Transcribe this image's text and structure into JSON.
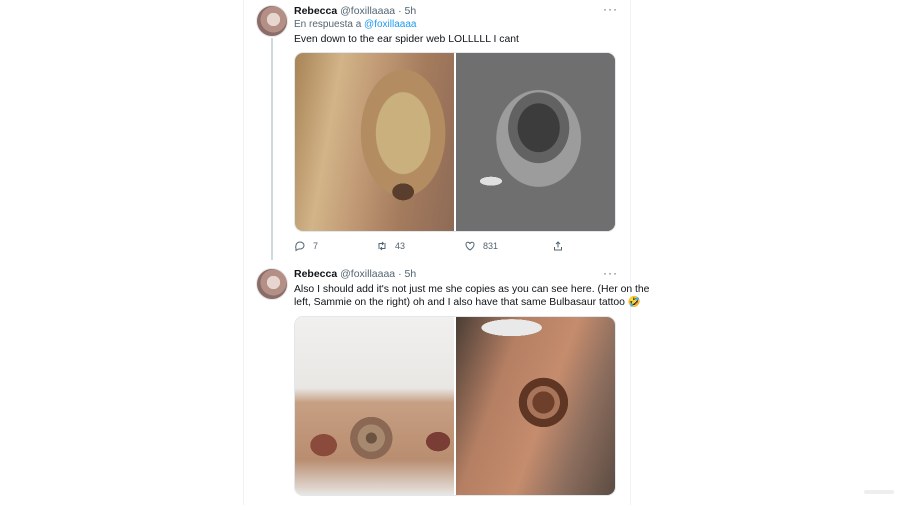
{
  "tweets": [
    {
      "name": "Rebecca",
      "handle": "@foxillaaaa",
      "dot": "·",
      "time": "5h",
      "more": "···",
      "reply_prefix": "En respuesta a",
      "reply_mention": "@foxillaaaa",
      "text": "Even down to the ear spider web LOLLLLL I cant",
      "actions": {
        "replies": "7",
        "retweets": "43",
        "likes": "831"
      }
    },
    {
      "name": "Rebecca",
      "handle": "@foxillaaaa",
      "dot": "·",
      "time": "5h",
      "more": "···",
      "text_lines": [
        "Also I should add it's not just me she copies as you can see here. (Her on the",
        "left, Sammie on the right) oh and I also have that same Bulbasaur tattoo 🤣"
      ]
    }
  ],
  "colors": {
    "link": "#1d9bf0",
    "secondary_text": "#536471",
    "primary_text": "#0f1419"
  },
  "icons": [
    "reply-icon",
    "retweet-icon",
    "like-icon",
    "share-icon",
    "more-icon"
  ]
}
